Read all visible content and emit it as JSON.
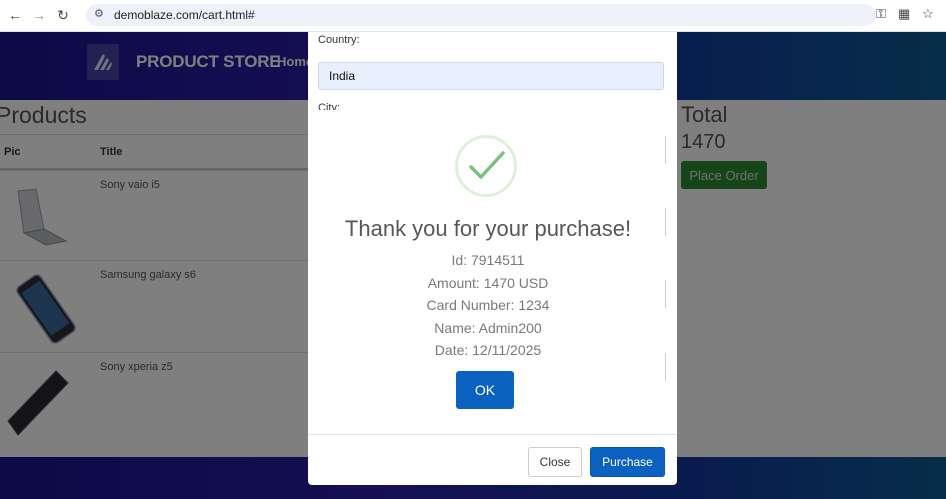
{
  "browser": {
    "url": "demoblaze.com/cart.html#"
  },
  "site": {
    "brand": "PRODUCT STORE",
    "nav_home": "Home"
  },
  "cart": {
    "products_heading": "Products",
    "col_pic": "Pic",
    "col_title": "Title",
    "items": [
      {
        "title": "Sony vaio i5"
      },
      {
        "title": "Samsung galaxy s6"
      },
      {
        "title": "Sony xperia z5"
      }
    ],
    "total_heading": "Total",
    "total_value": "1470",
    "place_order_label": "Place Order"
  },
  "order_form": {
    "country_label": "Country:",
    "country_value": "India",
    "city_label": "City:",
    "close_label": "Close",
    "purchase_label": "Purchase"
  },
  "alert": {
    "title": "Thank you for your purchase!",
    "lines": [
      "Id: 7914511",
      "Amount: 1470 USD",
      "Card Number: 1234",
      "Name: Admin200",
      "Date: 12/11/2025"
    ],
    "ok_label": "OK"
  },
  "colors": {
    "primary_button": "#0b61c0",
    "success_button": "#2a8a33",
    "check_green": "#7ac37c"
  }
}
